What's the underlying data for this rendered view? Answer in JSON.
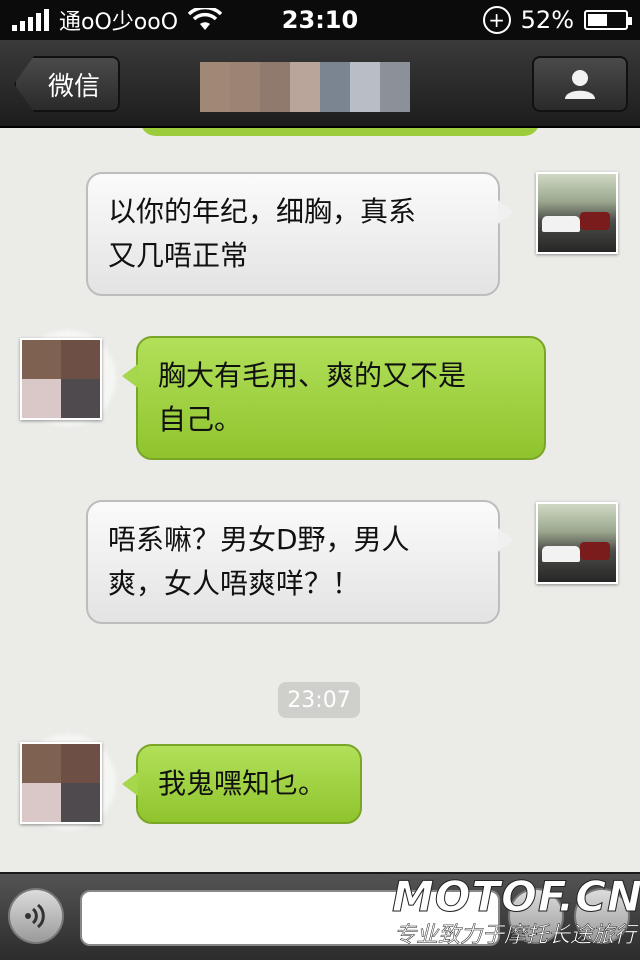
{
  "status_bar": {
    "carrier": "通oO少ooO",
    "time": "23:10",
    "battery": "52%",
    "battery_level": 0.52
  },
  "nav": {
    "back_label": "微信",
    "title_blur_colors": [
      "#a08876",
      "#9b8474",
      "#8f7a6d",
      "#b9a59a",
      "#7b8591",
      "#b9bec6",
      "#8b9099"
    ]
  },
  "messages": [
    {
      "side": "right",
      "style": "white",
      "avatar": "street-photo",
      "text_lines": [
        "以你的年纪，细胸，真系",
        "又几唔正常"
      ]
    },
    {
      "side": "left",
      "style": "green",
      "avatar": "pixelated-photo",
      "text_lines": [
        "胸大有毛用、爽的又不是",
        "自己。"
      ]
    },
    {
      "side": "right",
      "style": "white",
      "avatar": "street-photo",
      "text_lines": [
        "唔系嘛？男女D野，男人",
        "爽，女人唔爽咩？！"
      ]
    },
    {
      "side": "left",
      "style": "green",
      "avatar": "pixelated-photo",
      "text_lines": [
        "我鬼嘿知乜。"
      ]
    }
  ],
  "timestamp": "23:07",
  "input_bar": {
    "placeholder": ""
  },
  "watermark": {
    "logo": "MOTOF.CN",
    "slogan": "专业致力于摩托长途旅行"
  },
  "colors": {
    "green_bubble": "#9ccc3c",
    "white_bubble": "#f4f4f4",
    "background": "#ebebe8"
  },
  "avatar_pixel_colors": [
    "#7f6152",
    "#6e4f45",
    "#d9c8c7",
    "#4f4a4e"
  ]
}
